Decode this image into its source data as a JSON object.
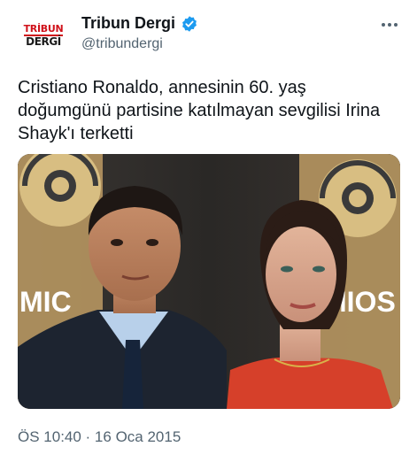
{
  "account": {
    "display_name": "Tribun Dergi",
    "handle": "@tribundergi",
    "logo_line1": "TRİBUN",
    "logo_line2": "DERGİ",
    "verified": true,
    "verified_color": "#1d9bf0"
  },
  "tweet": {
    "text": "Cristiano Ronaldo, annesinin 60. yaş doğumgünü partisine katılmayan sevgilisi Irina Shayk'ı terketti",
    "timestamp": "ÖS 10:40 · 16 Oca 2015"
  },
  "media": {
    "backdrop_text_left": "MIC",
    "backdrop_text_right": "MIOS",
    "backdrop_color": "#c9a86a",
    "dress_color": "#d6402a"
  },
  "icons": {
    "verified": "verified-badge-icon",
    "more": "more-horizontal-icon"
  }
}
